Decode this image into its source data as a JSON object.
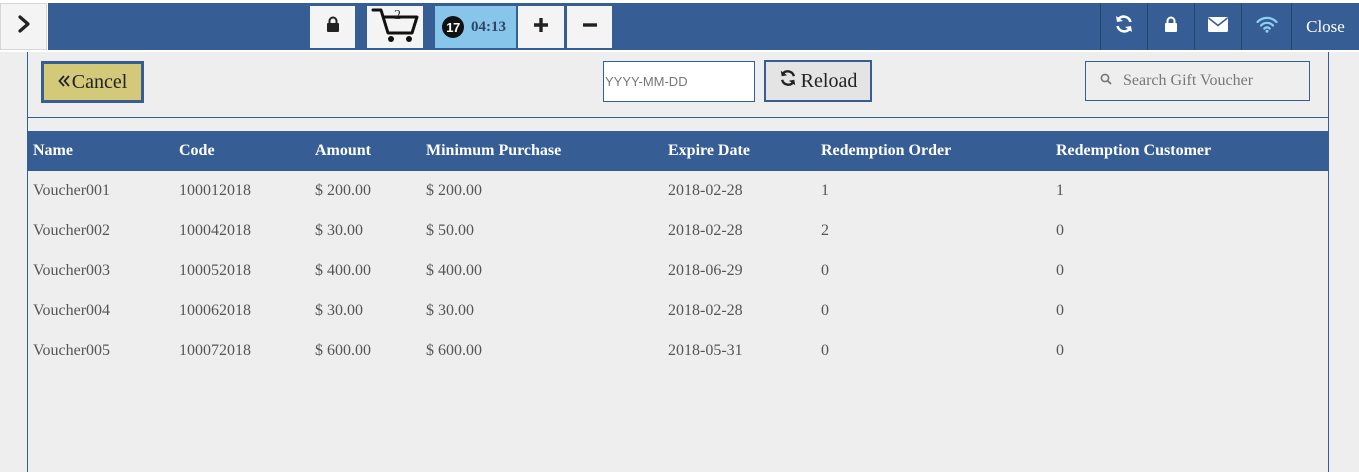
{
  "topbar": {
    "cart_count": "2",
    "timer_badge": "17",
    "timer_time": "04:13",
    "close_label": "Close",
    "colors": {
      "bar": "#365d94",
      "timer_bg": "#87c6ea",
      "wifi": "#8fd0f2"
    }
  },
  "toolbar": {
    "cancel_label": "Cancel",
    "date_placeholder": "YYYY-MM-DD",
    "reload_label": "Reload",
    "search_placeholder": "Search Gift Voucher",
    "cancel_color": "#d4c879"
  },
  "table": {
    "headers": [
      "Name",
      "Code",
      "Amount",
      "Minimum Purchase",
      "Expire Date",
      "Redemption Order",
      "Redemption Customer"
    ],
    "rows": [
      [
        "Voucher001",
        "100012018",
        "$ 200.00",
        "$ 200.00",
        "2018-02-28",
        "1",
        "1"
      ],
      [
        "Voucher002",
        "100042018",
        "$ 30.00",
        "$ 50.00",
        "2018-02-28",
        "2",
        "0"
      ],
      [
        "Voucher003",
        "100052018",
        "$ 400.00",
        "$ 400.00",
        "2018-06-29",
        "0",
        "0"
      ],
      [
        "Voucher004",
        "100062018",
        "$ 30.00",
        "$ 30.00",
        "2018-02-28",
        "0",
        "0"
      ],
      [
        "Voucher005",
        "100072018",
        "$ 600.00",
        "$ 600.00",
        "2018-05-31",
        "0",
        "0"
      ]
    ]
  },
  "icons": [
    "chevron-right-icon",
    "lock-icon",
    "cart-icon",
    "plus-icon",
    "minus-icon",
    "refresh-icon",
    "envelope-icon",
    "wifi-icon",
    "search-icon",
    "double-chevron-left-icon"
  ]
}
